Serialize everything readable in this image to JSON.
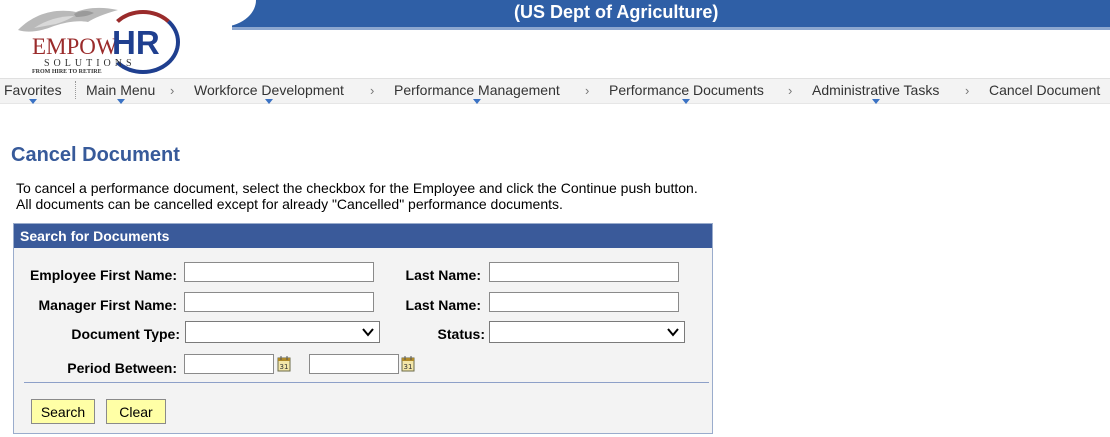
{
  "header": {
    "title": "(US Dept of Agriculture)",
    "logo": {
      "brand_part1": "EMPOW",
      "brand_part2": "HR",
      "subtitle": "SOLUTIONS",
      "tagline": "FROM HIRE TO RETIRE"
    }
  },
  "nav": {
    "items": [
      {
        "label": "Favorites"
      },
      {
        "label": "Main Menu"
      },
      {
        "label": "Workforce Development"
      },
      {
        "label": "Performance Management"
      },
      {
        "label": "Performance Documents"
      },
      {
        "label": "Administrative Tasks"
      },
      {
        "label": "Cancel Document"
      }
    ],
    "separator": "›"
  },
  "page": {
    "title": "Cancel Document",
    "instructions": "To cancel a performance document, select the checkbox for the Employee and click the Continue push button. All documents can be cancelled except for already \"Cancelled\" performance documents."
  },
  "search": {
    "header": "Search for Documents",
    "employee_first_name_label": "Employee First Name:",
    "employee_first_name_value": "",
    "employee_last_name_label": "Last Name:",
    "employee_last_name_value": "",
    "manager_first_name_label": "Manager First Name:",
    "manager_first_name_value": "",
    "manager_last_name_label": "Last Name:",
    "manager_last_name_value": "",
    "document_type_label": "Document Type:",
    "document_type_value": "",
    "status_label": "Status:",
    "status_value": "",
    "period_between_label": "Period Between:",
    "period_start_value": "",
    "period_end_value": "",
    "search_button": "Search",
    "clear_button": "Clear"
  },
  "colors": {
    "header_band": "#2f5fa6",
    "panel_header": "#3a5a9a",
    "page_title": "#375a9a",
    "button_bg": "#ffffa6",
    "nav_indicator": "#3a72c4"
  },
  "icons": {
    "dropdown": "chevron-down-icon",
    "calendar": "calendar-icon",
    "logo_mark": "eagle-icon"
  }
}
